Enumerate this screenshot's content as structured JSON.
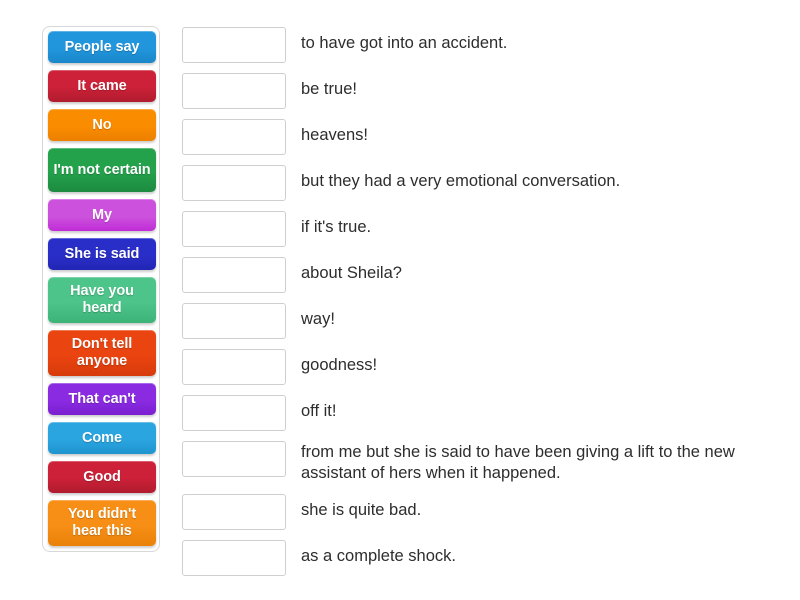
{
  "activity": {
    "type": "match-up",
    "tiles": [
      {
        "label": "People say",
        "color": "#2196dd",
        "color_bottom": "#1a86c9",
        "lines": 1
      },
      {
        "label": "It came",
        "color": "#cc2138",
        "color_bottom": "#b01b2e",
        "lines": 1
      },
      {
        "label": "No",
        "color": "#fa8c00",
        "color_bottom": "#ec8000",
        "lines": 1
      },
      {
        "label": "I'm not certain",
        "color": "#23a14b",
        "color_bottom": "#1d8b40",
        "lines": 2
      },
      {
        "label": "My",
        "color": "#cc52dd",
        "color_bottom": "#c02bd6",
        "lines": 1
      },
      {
        "label": "She is said",
        "color": "#2a2ec9",
        "color_bottom": "#2226b4",
        "lines": 1
      },
      {
        "label": "Have you heard",
        "color": "#4cc48a",
        "color_bottom": "#3cb478",
        "lines": 2
      },
      {
        "label": "Don't tell anyone",
        "color": "#ea4410",
        "color_bottom": "#d73b0b",
        "lines": 2
      },
      {
        "label": "That can't",
        "color": "#8a2be2",
        "color_bottom": "#7a1fd0",
        "lines": 1
      },
      {
        "label": "Come",
        "color": "#2ba5e0",
        "color_bottom": "#1f94cf",
        "lines": 1
      },
      {
        "label": "Good",
        "color": "#cc2138",
        "color_bottom": "#b01b2e",
        "lines": 1
      },
      {
        "label": "You didn't hear this",
        "color": "#f78f16",
        "color_bottom": "#ea8209",
        "lines": 2
      }
    ],
    "rows": [
      {
        "answer": "to have got into an accident.",
        "tall": false
      },
      {
        "answer": "be true!",
        "tall": false
      },
      {
        "answer": "heavens!",
        "tall": false
      },
      {
        "answer": "but they had a very emotional conversation.",
        "tall": false
      },
      {
        "answer": "if it's true.",
        "tall": false
      },
      {
        "answer": "about Sheila?",
        "tall": false
      },
      {
        "answer": "way!",
        "tall": false
      },
      {
        "answer": "goodness!",
        "tall": false
      },
      {
        "answer": "off it!",
        "tall": false
      },
      {
        "answer": "from me but she is said to have been giving a lift to the new assistant of hers when it happened.",
        "tall": true
      },
      {
        "answer": "she is quite bad.",
        "tall": false
      },
      {
        "answer": "as a complete shock.",
        "tall": false
      }
    ]
  }
}
